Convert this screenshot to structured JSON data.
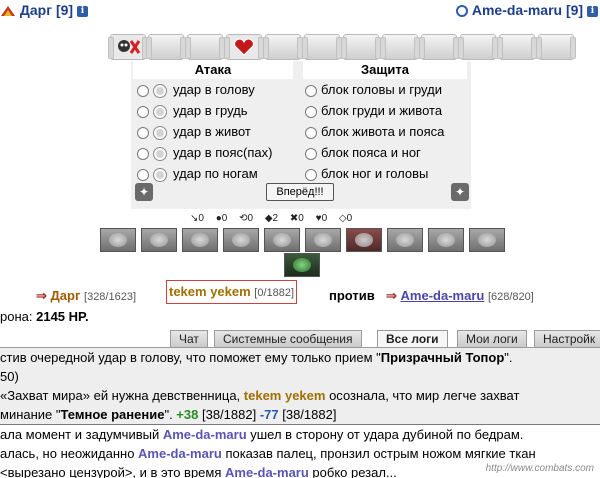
{
  "header": {
    "left_name": "Дарг",
    "left_level": "[9]",
    "right_name": "Ame-da-maru",
    "right_level": "[9]",
    "info_glyph": "i"
  },
  "panel": {
    "attack_title": "Атака",
    "defense_title": "Защита",
    "attack_options": [
      "удар в голову",
      "удар в грудь",
      "удар в живот",
      "удар в пояс(пах)",
      "удар по ногам"
    ],
    "defense_options": [
      "блок головы и груди",
      "блок груди и живота",
      "блок живота и пояса",
      "блок пояса и ног",
      "блок ног и головы"
    ],
    "forward_button": "Вперёд!!!"
  },
  "stats": [
    "↘0",
    "●0",
    "⟲0",
    "◆2",
    "✖0",
    "♥0",
    "◇0"
  ],
  "versus": {
    "arrow": "⇒",
    "ally_name": "Дарг",
    "ally_hp": "[328/1623]",
    "me_name": "tekem yekem",
    "me_hp": "[0/1882]",
    "vs_word": "против",
    "enemy_name": "Ame-da-maru",
    "enemy_hp": "[628/820]"
  },
  "damage": {
    "label": "рона:",
    "value": "2145 HP."
  },
  "tabs": [
    "Чат",
    "Системные сообщения",
    "Все логи",
    "Мои логи",
    "Настройк"
  ],
  "active_tab": "Все логи",
  "log": {
    "line1_a": "стив очередной удар в голову, что поможет ему только прием \"",
    "line1_b": "Призрачный Топор",
    "line1_c": "\".",
    "line2": "50)",
    "line3_a": "«Захват мира» ей нужна девственница, ",
    "line3_b": "tekem yekem",
    "line3_c": " осознала, что мир легче захват",
    "line4_a": "минание \"",
    "line4_b": "Темное ранение",
    "line4_c": "\". ",
    "line4_d": "+38",
    "line4_e": " [38/1882] ",
    "line4_f": "-77",
    "line4_g": " [38/1882]",
    "line5_a": "ала момент и задумчивый ",
    "line5_b": "Ame-da-maru",
    "line5_c": " ушел в сторону от удара дубиной по бедрам.",
    "line6_a": "алась, но неожиданно ",
    "line6_b": "Ame-da-maru",
    "line6_c": " показав палец, пронзил острым ножом мягкие ткан",
    "line7_a": " <вырезано цензурой>, и в это время ",
    "line7_b": "Ame-da-maru",
    "line7_c": " робко резал..."
  },
  "watermark": "http://www.combats.com"
}
